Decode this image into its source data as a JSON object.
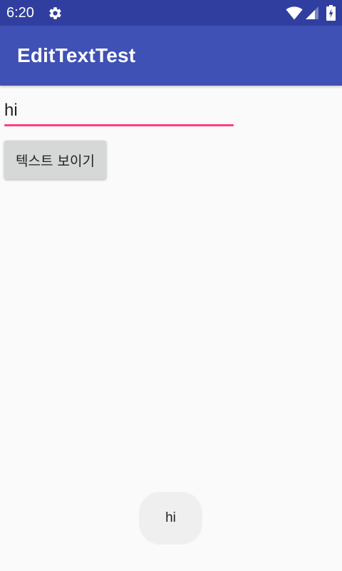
{
  "status_bar": {
    "time": "6:20",
    "icons": [
      "gear-icon",
      "wifi-icon",
      "signal-icon",
      "battery-icon"
    ],
    "background_color": "#303f9f"
  },
  "app_bar": {
    "title": "EditTextTest",
    "background_color": "#3f51b5"
  },
  "edit_text": {
    "value": "hi",
    "underline_color": "#ff4081"
  },
  "button": {
    "label": "텍스트 보이기"
  },
  "toast": {
    "message": "hi"
  }
}
